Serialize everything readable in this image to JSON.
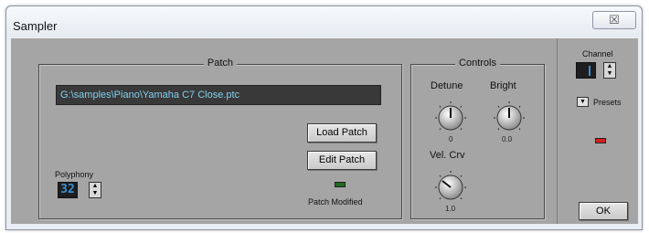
{
  "window": {
    "title": "Sampler",
    "close_glyph": "☒"
  },
  "patch": {
    "group_title": "Patch",
    "path": "G:\\samples\\Piano\\Yamaha C7 Close.ptc",
    "load_button": "Load Patch",
    "edit_button": "Edit Patch",
    "polyphony_label": "Polyphony",
    "polyphony_value": "32",
    "modified_label": "Patch Modified"
  },
  "controls": {
    "group_title": "Controls",
    "detune": {
      "label": "Detune",
      "value": "0"
    },
    "bright": {
      "label": "Bright",
      "value": "0.0"
    },
    "vel_crv": {
      "label": "Vel. Crv",
      "value": "1.0"
    }
  },
  "sidebar": {
    "channel_label": "Channel",
    "presets_label": "Presets",
    "ok_button": "OK"
  },
  "colors": {
    "panel": "#a5a5a5",
    "path_text": "#7fd0f0",
    "led_green": "#1f6b1f",
    "led_red": "#d42020",
    "digit_blue": "#3a8fd8"
  },
  "icons": [
    "close-icon",
    "spin-up-down-icon",
    "dropdown-arrow-icon"
  ]
}
